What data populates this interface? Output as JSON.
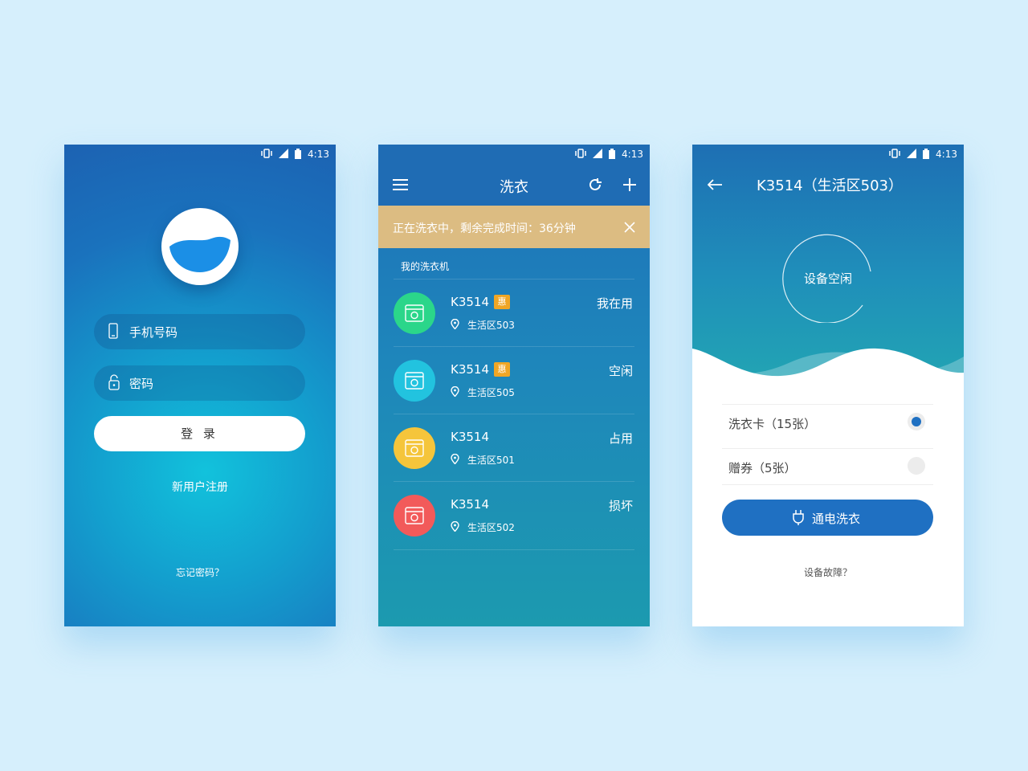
{
  "status_bar": {
    "time": "4:13"
  },
  "login": {
    "phone_placeholder": "手机号码",
    "password_placeholder": "密码",
    "login_label": "登 录",
    "register_label": "新用户注册",
    "forgot_label": "忘记密码？"
  },
  "list": {
    "title": "洗衣",
    "banner_text": "正在洗衣中，剩余完成时间：36分钟",
    "section_title": "我的洗衣机",
    "promo_badge": "惠",
    "machines": [
      {
        "name": "K3514",
        "badge": true,
        "location": "生活区503",
        "status": "我在用",
        "color": "#2bd68a"
      },
      {
        "name": "K3514",
        "badge": true,
        "location": "生活区505",
        "status": "空闲",
        "color": "#22c3df"
      },
      {
        "name": "K3514",
        "badge": false,
        "location": "生活区501",
        "status": "占用",
        "color": "#f5c53b"
      },
      {
        "name": "K3514",
        "badge": false,
        "location": "生活区502",
        "status": "损坏",
        "color": "#f25a5a"
      }
    ]
  },
  "detail": {
    "title": "K3514（生活区503）",
    "device_status": "设备空闲",
    "options": [
      {
        "label": "洗衣卡（15张）",
        "selected": true
      },
      {
        "label": "赠券（5张）",
        "selected": false
      }
    ],
    "power_label": "通电洗衣",
    "fault_label": "设备故障？"
  },
  "colors": {
    "background": "#d6effc",
    "primary": "#1f70c2",
    "banner": "#dcbc82",
    "badge": "#f0a625"
  }
}
